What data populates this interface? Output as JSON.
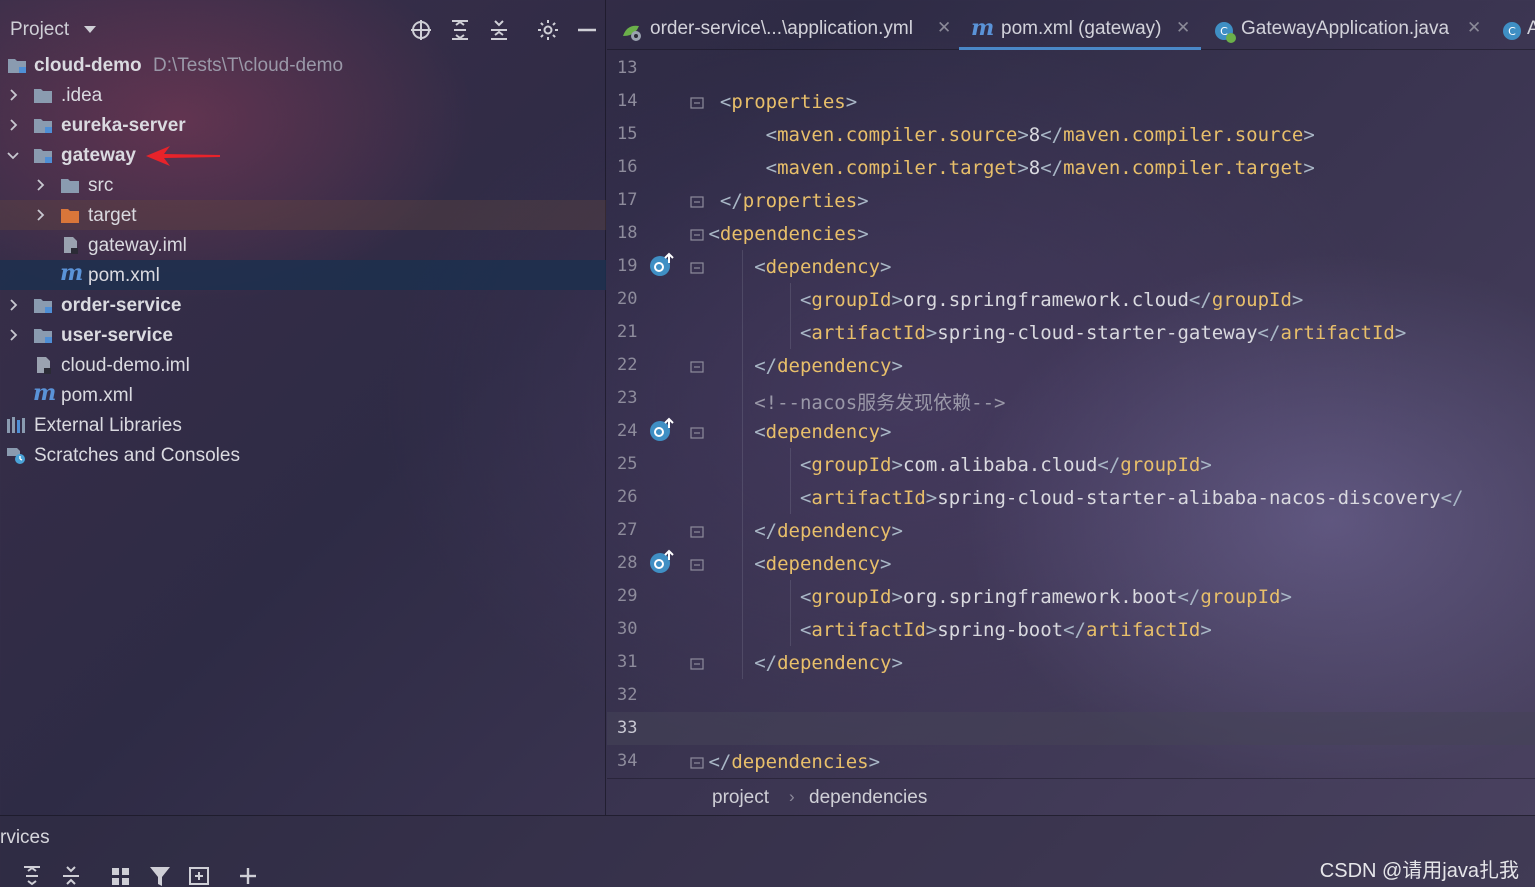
{
  "project_panel": {
    "title": "Project",
    "tree": [
      {
        "label": "cloud-demo",
        "path": "D:\\Tests\\T\\cloud-demo",
        "type": "module",
        "bold": true
      },
      {
        "label": ".idea",
        "type": "folder"
      },
      {
        "label": "eureka-server",
        "type": "module",
        "bold": true
      },
      {
        "label": "gateway",
        "type": "module",
        "bold": true
      },
      {
        "label": "src",
        "type": "folder"
      },
      {
        "label": "target",
        "type": "excluded-folder"
      },
      {
        "label": "gateway.iml",
        "type": "iml-file"
      },
      {
        "label": "pom.xml",
        "type": "maven-file",
        "selected": true
      },
      {
        "label": "order-service",
        "type": "module",
        "bold": true
      },
      {
        "label": "user-service",
        "type": "module",
        "bold": true
      },
      {
        "label": "cloud-demo.iml",
        "type": "iml-file"
      },
      {
        "label": "pom.xml",
        "type": "maven-file"
      },
      {
        "label": "External Libraries",
        "type": "libraries"
      },
      {
        "label": "Scratches and Consoles",
        "type": "scratches"
      }
    ],
    "annotation": "red-arrow pointing at gateway"
  },
  "tabs": [
    {
      "label": "order-service\\...\\application.yml",
      "icon": "yml-spring-icon",
      "active": false
    },
    {
      "label": "pom.xml (gateway)",
      "icon": "maven-icon",
      "active": true
    },
    {
      "label": "GatewayApplication.java",
      "icon": "spring-class-icon",
      "active": false
    },
    {
      "label": "A",
      "icon": "class-icon",
      "active": false
    }
  ],
  "editor": {
    "line_numbers": [
      "13",
      "14",
      "15",
      "16",
      "17",
      "18",
      "19",
      "20",
      "21",
      "22",
      "23",
      "24",
      "25",
      "26",
      "27",
      "28",
      "29",
      "30",
      "31",
      "32",
      "33",
      "34"
    ],
    "current_line": "33",
    "lines": [
      {
        "indent": "",
        "parts": []
      },
      {
        "indent": "  ",
        "parts": [
          [
            "br",
            "<"
          ],
          [
            "tag",
            "properties"
          ],
          [
            "br",
            ">"
          ]
        ]
      },
      {
        "indent": "      ",
        "parts": [
          [
            "br",
            "<"
          ],
          [
            "tag",
            "maven.compiler.source"
          ],
          [
            "br",
            ">"
          ],
          [
            "txt",
            "8"
          ],
          [
            "br",
            "</"
          ],
          [
            "tag",
            "maven.compiler.source"
          ],
          [
            "br",
            ">"
          ]
        ]
      },
      {
        "indent": "      ",
        "parts": [
          [
            "br",
            "<"
          ],
          [
            "tag",
            "maven.compiler.target"
          ],
          [
            "br",
            ">"
          ],
          [
            "txt",
            "8"
          ],
          [
            "br",
            "</"
          ],
          [
            "tag",
            "maven.compiler.target"
          ],
          [
            "br",
            ">"
          ]
        ]
      },
      {
        "indent": "  ",
        "parts": [
          [
            "br",
            "</"
          ],
          [
            "tag",
            "properties"
          ],
          [
            "br",
            ">"
          ]
        ]
      },
      {
        "indent": " ",
        "parts": [
          [
            "br",
            "<"
          ],
          [
            "tag",
            "dependencies"
          ],
          [
            "br",
            ">"
          ]
        ]
      },
      {
        "indent": "     ",
        "parts": [
          [
            "br",
            "<"
          ],
          [
            "tag",
            "dependency"
          ],
          [
            "br",
            ">"
          ]
        ]
      },
      {
        "indent": "         ",
        "parts": [
          [
            "br",
            "<"
          ],
          [
            "tag",
            "groupId"
          ],
          [
            "br",
            ">"
          ],
          [
            "txt",
            "org.springframework.cloud"
          ],
          [
            "br",
            "</"
          ],
          [
            "tag",
            "groupId"
          ],
          [
            "br",
            ">"
          ]
        ]
      },
      {
        "indent": "         ",
        "parts": [
          [
            "br",
            "<"
          ],
          [
            "tag",
            "artifactId"
          ],
          [
            "br",
            ">"
          ],
          [
            "txt",
            "spring-cloud-starter-gateway"
          ],
          [
            "br",
            "</"
          ],
          [
            "tag",
            "artifactId"
          ],
          [
            "br",
            ">"
          ]
        ]
      },
      {
        "indent": "     ",
        "parts": [
          [
            "br",
            "</"
          ],
          [
            "tag",
            "dependency"
          ],
          [
            "br",
            ">"
          ]
        ]
      },
      {
        "indent": "     ",
        "parts": [
          [
            "cmt",
            "<!--nacos服务发现依赖-->"
          ]
        ]
      },
      {
        "indent": "     ",
        "parts": [
          [
            "br",
            "<"
          ],
          [
            "tag",
            "dependency"
          ],
          [
            "br",
            ">"
          ]
        ]
      },
      {
        "indent": "         ",
        "parts": [
          [
            "br",
            "<"
          ],
          [
            "tag",
            "groupId"
          ],
          [
            "br",
            ">"
          ],
          [
            "txt",
            "com.alibaba.cloud"
          ],
          [
            "br",
            "</"
          ],
          [
            "tag",
            "groupId"
          ],
          [
            "br",
            ">"
          ]
        ]
      },
      {
        "indent": "         ",
        "parts": [
          [
            "br",
            "<"
          ],
          [
            "tag",
            "artifactId"
          ],
          [
            "br",
            ">"
          ],
          [
            "txt",
            "spring-cloud-starter-alibaba-nacos-discovery"
          ],
          [
            "br",
            "</"
          ]
        ]
      },
      {
        "indent": "     ",
        "parts": [
          [
            "br",
            "</"
          ],
          [
            "tag",
            "dependency"
          ],
          [
            "br",
            ">"
          ]
        ]
      },
      {
        "indent": "     ",
        "parts": [
          [
            "br",
            "<"
          ],
          [
            "tag",
            "dependency"
          ],
          [
            "br",
            ">"
          ]
        ]
      },
      {
        "indent": "         ",
        "parts": [
          [
            "br",
            "<"
          ],
          [
            "tag",
            "groupId"
          ],
          [
            "br",
            ">"
          ],
          [
            "txt",
            "org.springframework.boot"
          ],
          [
            "br",
            "</"
          ],
          [
            "tag",
            "groupId"
          ],
          [
            "br",
            ">"
          ]
        ]
      },
      {
        "indent": "         ",
        "parts": [
          [
            "br",
            "<"
          ],
          [
            "tag",
            "artifactId"
          ],
          [
            "br",
            ">"
          ],
          [
            "txt",
            "spring-boot"
          ],
          [
            "br",
            "</"
          ],
          [
            "tag",
            "artifactId"
          ],
          [
            "br",
            ">"
          ]
        ]
      },
      {
        "indent": "     ",
        "parts": [
          [
            "br",
            "</"
          ],
          [
            "tag",
            "dependency"
          ],
          [
            "br",
            ">"
          ]
        ]
      },
      {
        "indent": "",
        "parts": []
      },
      {
        "indent": "",
        "parts": []
      },
      {
        "indent": " ",
        "parts": [
          [
            "br",
            "</"
          ],
          [
            "tag",
            "dependencies"
          ],
          [
            "br",
            ">"
          ]
        ]
      }
    ]
  },
  "breadcrumb": [
    "project",
    "dependencies"
  ],
  "services": {
    "title": "rvices"
  },
  "watermark": "CSDN @请用java扎我",
  "colors": {
    "tag": "#e8bf6a",
    "bracket": "#a9b7c6",
    "text": "#d9d9df",
    "comment": "#9a98a8",
    "selection": "#1c304e",
    "tab_underline": "#4a88c7",
    "maven": "#5a93d8",
    "annotation": "#e8232a"
  }
}
